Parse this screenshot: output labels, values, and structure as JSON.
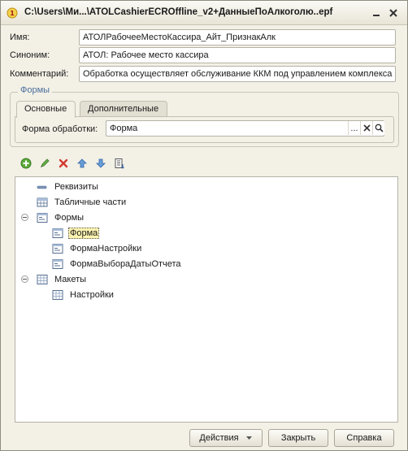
{
  "window": {
    "title": "C:\\Users\\Ми...\\ATOLCashierECROffline_v2+ДанныеПоАлкоголю..epf"
  },
  "form": {
    "name_label": "Имя:",
    "name_value": "АТОЛРабочееМестоКассира_Айт_ПризнакАлк",
    "synonym_label": "Синоним:",
    "synonym_value": "АТОЛ: Рабочее место кассира",
    "comment_label": "Комментарий:",
    "comment_value": "Обработка осуществляет обслуживание ККМ под управлением комплекса"
  },
  "forms_group": {
    "legend": "Формы",
    "tabs": [
      {
        "label": "Основные",
        "active": true
      },
      {
        "label": "Дополнительные",
        "active": false
      }
    ],
    "processing_form_label": "Форма обработки:",
    "processing_form_value": "Форма",
    "select_glyph": "...",
    "clear_glyph": "✕",
    "open_glyph": "🔍"
  },
  "toolbar": {
    "icons": [
      "add-icon",
      "edit-icon",
      "delete-icon",
      "move-up-icon",
      "move-down-icon",
      "sort-icon"
    ]
  },
  "tree": {
    "items": [
      {
        "label": "Реквизиты",
        "level": 0,
        "icon": "attributes-icon"
      },
      {
        "label": "Табличные части",
        "level": 0,
        "icon": "tabular-sections-icon"
      },
      {
        "label": "Формы",
        "level": 0,
        "icon": "forms-icon",
        "expanded": true
      },
      {
        "label": "Форма",
        "level": 1,
        "icon": "form-icon",
        "selected": true
      },
      {
        "label": "ФормаНастройки",
        "level": 1,
        "icon": "form-icon"
      },
      {
        "label": "ФормаВыбораДатыОтчета",
        "level": 1,
        "icon": "form-icon"
      },
      {
        "label": "Макеты",
        "level": 0,
        "icon": "templates-icon",
        "expanded": true
      },
      {
        "label": "Настройки",
        "level": 1,
        "icon": "template-icon"
      }
    ]
  },
  "buttons": {
    "actions": "Действия",
    "close": "Закрыть",
    "help": "Справка"
  },
  "colors": {
    "window_bg": "#f3f0e6",
    "accent_legend": "#4a6f9c",
    "selection_bg": "#fdf3b0"
  }
}
